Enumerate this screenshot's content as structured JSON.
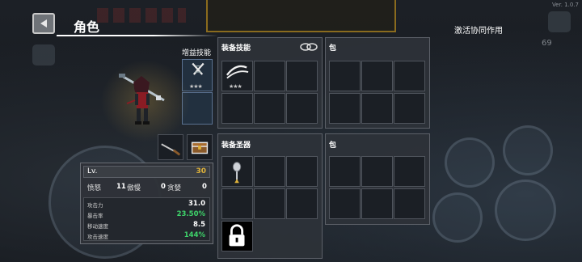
{
  "header": {
    "title": "角色",
    "synergy_label": "激活协同作用"
  },
  "version": "Ver. 1.0.7",
  "hud": {
    "counter": "69"
  },
  "character": {
    "gain_skill_label": "增益技能",
    "gain_skill_stars": "★★★",
    "weapon_slots": [
      "sword",
      "chest"
    ]
  },
  "skills_panel": {
    "label": "装备技能",
    "slot_stars": "★★★",
    "icon": "link-chain-icon"
  },
  "skills_bag": {
    "label": "包"
  },
  "relics_panel": {
    "label": "装备圣器",
    "lock_icon": "lock-icon"
  },
  "relics_bag": {
    "label": "包"
  },
  "stats": {
    "level_label": "Lv.",
    "level_value": "30",
    "sins": [
      {
        "label": "愤怒",
        "value": "11"
      },
      {
        "label": "傲慢",
        "value": "0"
      },
      {
        "label": "贪婪",
        "value": "0"
      }
    ],
    "attributes": [
      {
        "label": "攻击力",
        "value": "31.0",
        "color": "#ffffff"
      },
      {
        "label": "暴击率",
        "value": "23.50%",
        "color": "#3ed36a"
      },
      {
        "label": "移动速度",
        "value": "8.5",
        "color": "#ffffff"
      },
      {
        "label": "攻击速度",
        "value": "144%",
        "color": "#3ed36a"
      }
    ]
  }
}
